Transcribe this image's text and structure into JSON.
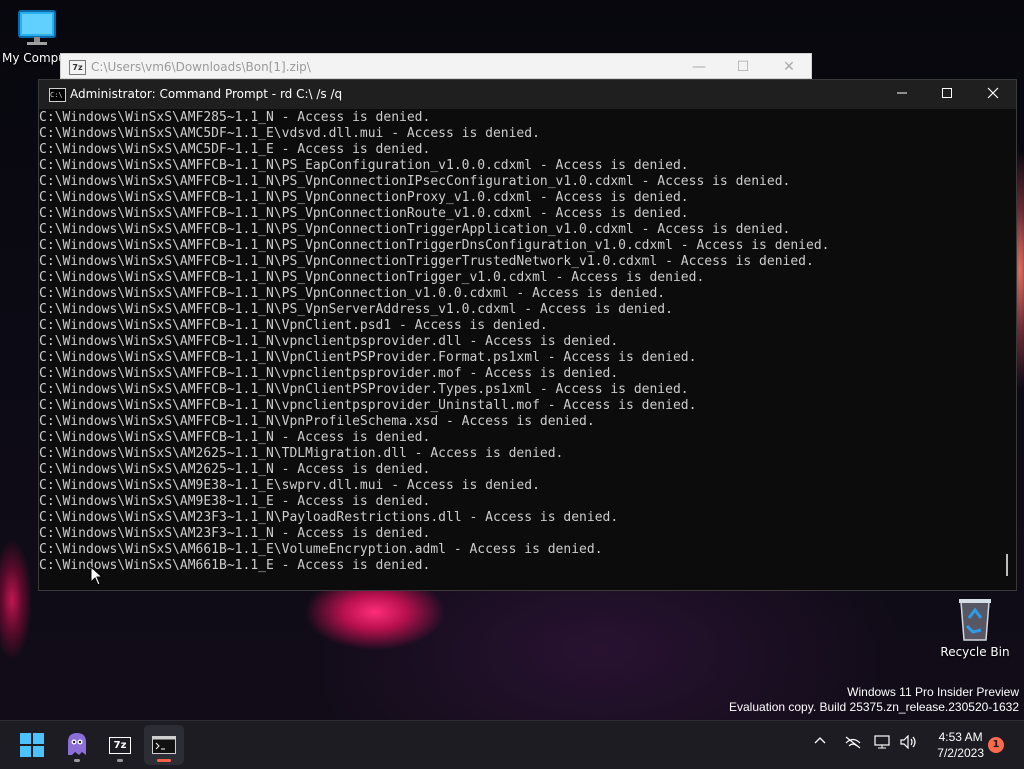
{
  "desktop": {
    "icons": [
      {
        "label": "My Compu",
        "icon": "computer-monitor-icon"
      },
      {
        "label": "Recycle Bin",
        "icon": "recycle-bin-icon"
      }
    ],
    "watermark": {
      "line1": "Windows 11 Pro Insider Preview",
      "line2": "Evaluation copy. Build 25375.zn_release.230520-1632"
    }
  },
  "zip_window": {
    "app_badge": "7z",
    "title": "C:\\Users\\vm6\\Downloads\\Bon[1].zip\\"
  },
  "cmd_window": {
    "app_badge": "C:\\",
    "title": "Administrator:  Command Prompt - rd  C:\\ /s /q",
    "controls": [
      "minimize-icon",
      "maximize-icon",
      "close-icon"
    ],
    "lines": [
      "C:\\Windows\\WinSxS\\AMF285~1.1_N - Access is denied.",
      "C:\\Windows\\WinSxS\\AMC5DF~1.1_E\\vdsvd.dll.mui - Access is denied.",
      "C:\\Windows\\WinSxS\\AMC5DF~1.1_E - Access is denied.",
      "C:\\Windows\\WinSxS\\AMFFCB~1.1_N\\PS_EapConfiguration_v1.0.0.cdxml - Access is denied.",
      "C:\\Windows\\WinSxS\\AMFFCB~1.1_N\\PS_VpnConnectionIPsecConfiguration_v1.0.cdxml - Access is denied.",
      "C:\\Windows\\WinSxS\\AMFFCB~1.1_N\\PS_VpnConnectionProxy_v1.0.cdxml - Access is denied.",
      "C:\\Windows\\WinSxS\\AMFFCB~1.1_N\\PS_VpnConnectionRoute_v1.0.cdxml - Access is denied.",
      "C:\\Windows\\WinSxS\\AMFFCB~1.1_N\\PS_VpnConnectionTriggerApplication_v1.0.cdxml - Access is denied.",
      "C:\\Windows\\WinSxS\\AMFFCB~1.1_N\\PS_VpnConnectionTriggerDnsConfiguration_v1.0.cdxml - Access is denied.",
      "C:\\Windows\\WinSxS\\AMFFCB~1.1_N\\PS_VpnConnectionTriggerTrustedNetwork_v1.0.cdxml - Access is denied.",
      "C:\\Windows\\WinSxS\\AMFFCB~1.1_N\\PS_VpnConnectionTrigger_v1.0.cdxml - Access is denied.",
      "C:\\Windows\\WinSxS\\AMFFCB~1.1_N\\PS_VpnConnection_v1.0.0.cdxml - Access is denied.",
      "C:\\Windows\\WinSxS\\AMFFCB~1.1_N\\PS_VpnServerAddress_v1.0.cdxml - Access is denied.",
      "C:\\Windows\\WinSxS\\AMFFCB~1.1_N\\VpnClient.psd1 - Access is denied.",
      "C:\\Windows\\WinSxS\\AMFFCB~1.1_N\\vpnclientpsprovider.dll - Access is denied.",
      "C:\\Windows\\WinSxS\\AMFFCB~1.1_N\\VpnClientPSProvider.Format.ps1xml - Access is denied.",
      "C:\\Windows\\WinSxS\\AMFFCB~1.1_N\\vpnclientpsprovider.mof - Access is denied.",
      "C:\\Windows\\WinSxS\\AMFFCB~1.1_N\\VpnClientPSProvider.Types.ps1xml - Access is denied.",
      "C:\\Windows\\WinSxS\\AMFFCB~1.1_N\\vpnclientpsprovider_Uninstall.mof - Access is denied.",
      "C:\\Windows\\WinSxS\\AMFFCB~1.1_N\\VpnProfileSchema.xsd - Access is denied.",
      "C:\\Windows\\WinSxS\\AMFFCB~1.1_N - Access is denied.",
      "C:\\Windows\\WinSxS\\AM2625~1.1_N\\TDLMigration.dll - Access is denied.",
      "C:\\Windows\\WinSxS\\AM2625~1.1_N - Access is denied.",
      "C:\\Windows\\WinSxS\\AM9E38~1.1_E\\swprv.dll.mui - Access is denied.",
      "C:\\Windows\\WinSxS\\AM9E38~1.1_E - Access is denied.",
      "C:\\Windows\\WinSxS\\AM23F3~1.1_N\\PayloadRestrictions.dll - Access is denied.",
      "C:\\Windows\\WinSxS\\AM23F3~1.1_N - Access is denied.",
      "C:\\Windows\\WinSxS\\AM661B~1.1_E\\VolumeEncryption.adml - Access is denied.",
      "C:\\Windows\\WinSxS\\AM661B~1.1_E - Access is denied."
    ]
  },
  "taskbar": {
    "apps": [
      {
        "name": "start",
        "icon": "windows-start-icon"
      },
      {
        "name": "app-ghost",
        "icon": "ghost-app-icon"
      },
      {
        "name": "7zip",
        "icon": "7zip-icon",
        "badge": "7z"
      },
      {
        "name": "terminal",
        "icon": "terminal-icon",
        "active": true
      }
    ],
    "tray": {
      "icons": [
        "chevron-up-icon",
        "network-off-icon",
        "display-network-icon",
        "volume-icon"
      ],
      "time": "4:53 AM",
      "date": "7/2/2023",
      "notification_count": "1"
    }
  },
  "colors": {
    "console_bg": "#0c0c0c",
    "console_text": "#cccccc",
    "titlebar_bg": "#1f1f1f",
    "taskbar_bg": "#1c1c22",
    "accent": "#ff5f4a",
    "start_blue": "#4cc2ff"
  }
}
